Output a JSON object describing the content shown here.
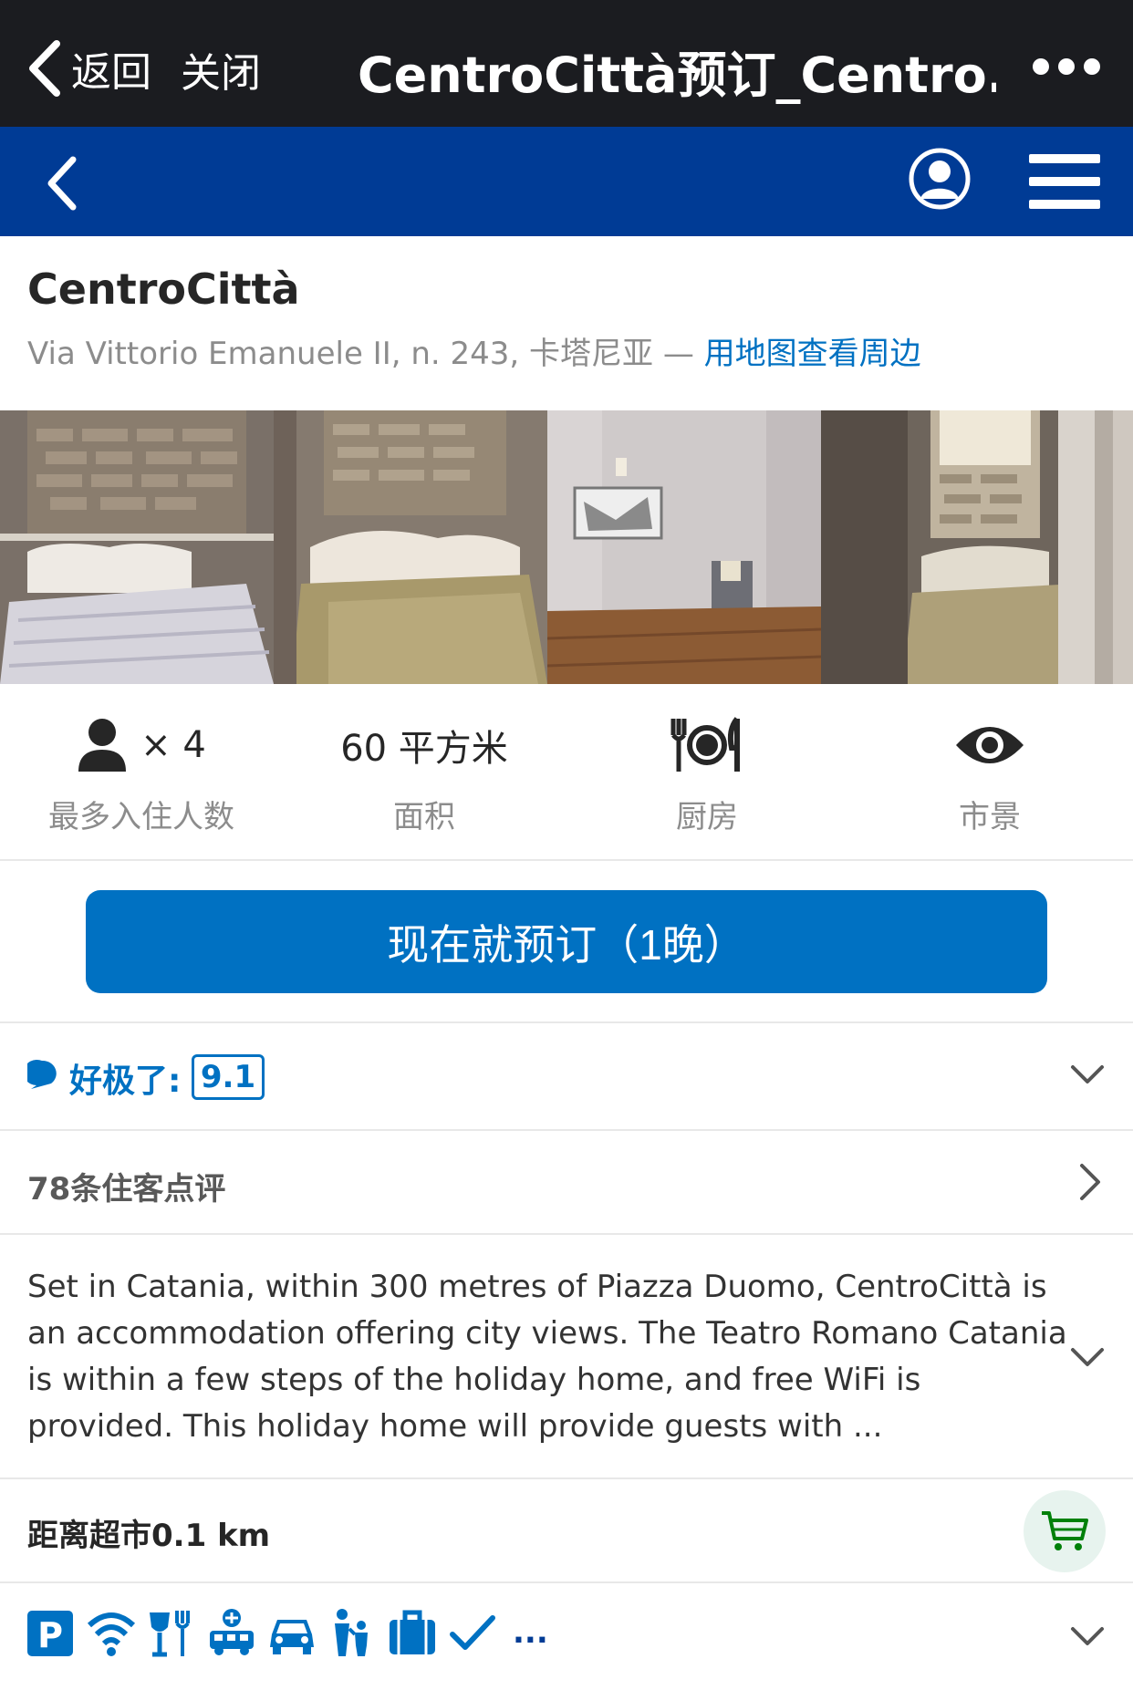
{
  "topbar": {
    "back_label": "返回",
    "close_label": "关闭",
    "title": "CentroCittà预订_Centro..."
  },
  "hotel": {
    "name": "CentroCittà",
    "address": "Via Vittorio Emanuele II, n. 243, 卡塔尼亚 — ",
    "map_link": "用地图查看周边"
  },
  "facts": [
    {
      "value": "× 4",
      "label": "最多入住人数",
      "icon": "person-icon"
    },
    {
      "value": "60 平方米",
      "label": "面积",
      "icon": ""
    },
    {
      "value": "",
      "label": "厨房",
      "icon": "kitchen-icon"
    },
    {
      "value": "",
      "label": "市景",
      "icon": "eye-icon"
    }
  ],
  "book_button": "现在就预订（1晚）",
  "rating": {
    "label": "好极了:",
    "score": "9.1"
  },
  "reviews": "78条住客点评",
  "description": "Set in Catania, within 300 metres of Piazza Duomo, CentroCittà is an accommodation offering city views. The Teatro Romano Catania is within a few steps of the holiday home, and free WiFi is provided. This holiday home will provide guests with ...",
  "distance": "距离超市0.1 km",
  "facilities": {
    "icons": [
      "parking-icon",
      "wifi-icon",
      "restaurant-icon",
      "airport-shuttle-icon",
      "car-icon",
      "family-icon",
      "luggage-icon",
      "check-icon"
    ],
    "more": "..."
  },
  "colors": {
    "topbar": "#1b1c20",
    "navbar": "#003b95",
    "accent": "#0071c2"
  }
}
